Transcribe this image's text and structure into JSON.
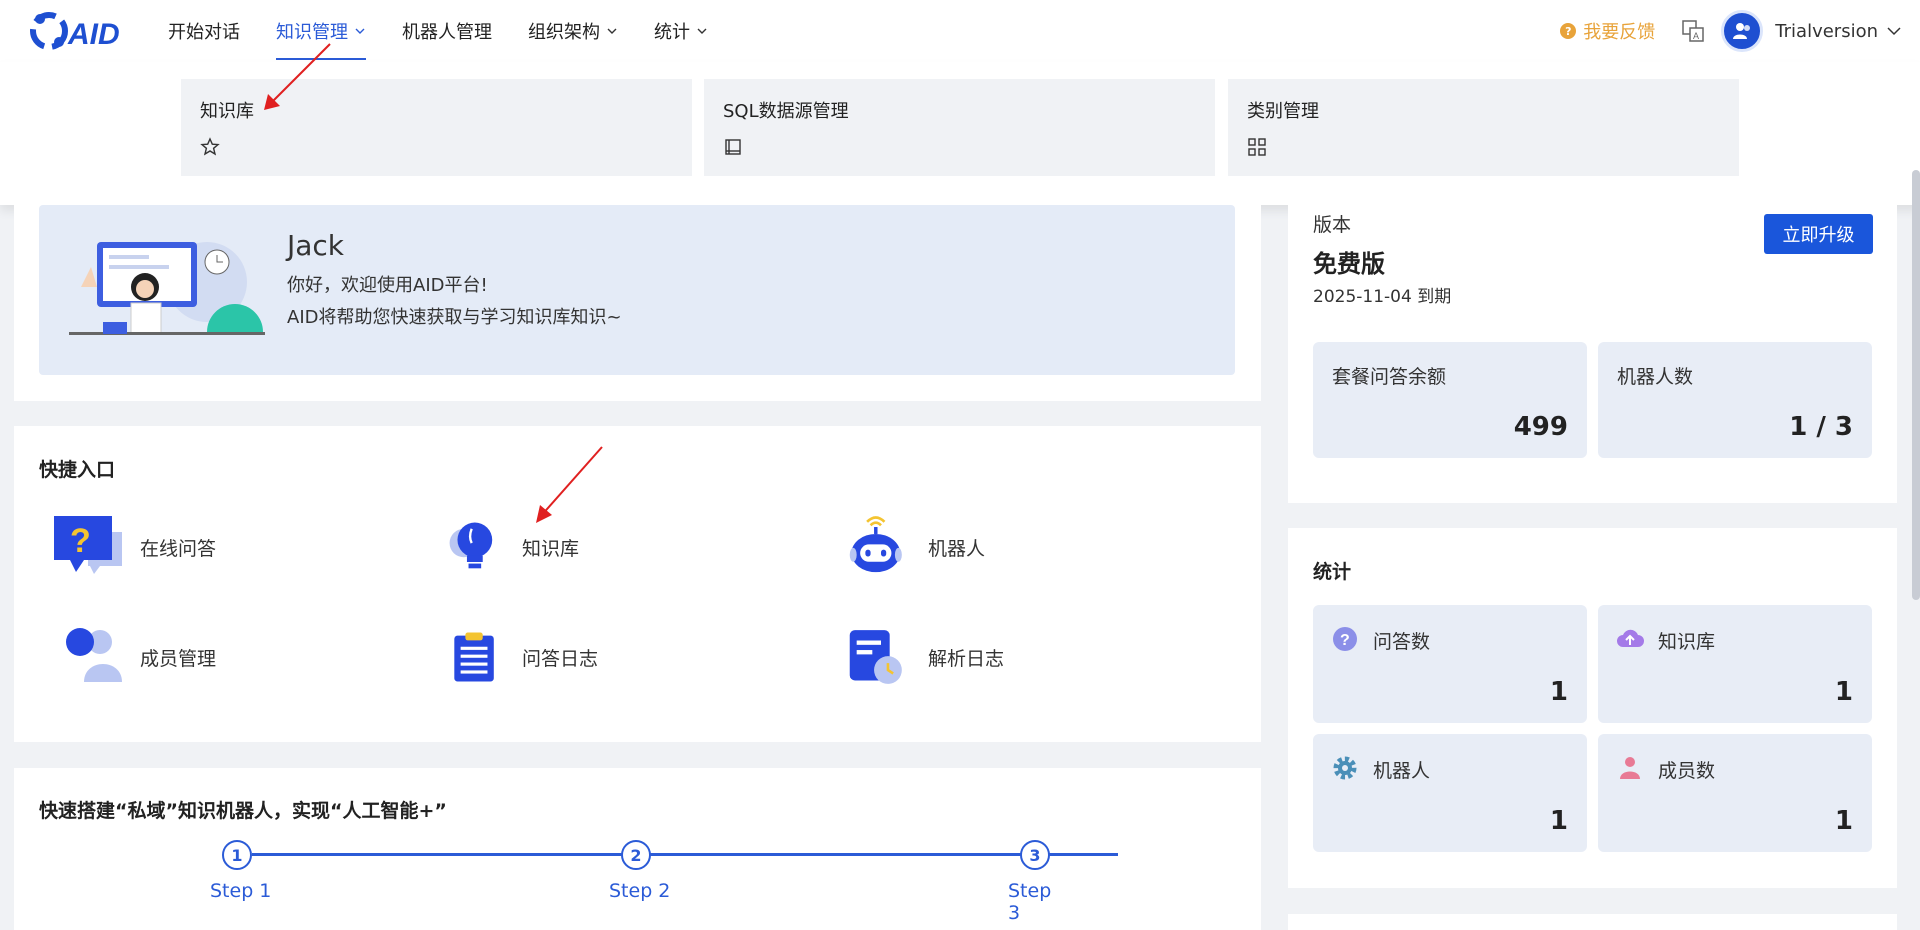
{
  "nav": {
    "items": [
      {
        "label": "开始对话",
        "has_chevron": false
      },
      {
        "label": "知识管理",
        "has_chevron": true,
        "active": true
      },
      {
        "label": "机器人管理",
        "has_chevron": false
      },
      {
        "label": "组织架构",
        "has_chevron": true
      },
      {
        "label": "统计",
        "has_chevron": true
      }
    ],
    "feedback": "我要反馈",
    "username": "Trialversion"
  },
  "dropdown": {
    "items": [
      {
        "label": "知识库",
        "icon": "star-icon"
      },
      {
        "label": "SQL数据源管理",
        "icon": "book-icon"
      },
      {
        "label": "类别管理",
        "icon": "grid-icon"
      }
    ]
  },
  "banner": {
    "name": "Jack",
    "line1": "你好，欢迎使用AID平台!",
    "line2": "AID将帮助您快速获取与学习知识库知识~"
  },
  "quick": {
    "title": "快捷入口",
    "items": [
      {
        "label": "在线问答",
        "icon": "question-bubble-icon"
      },
      {
        "label": "知识库",
        "icon": "lightbulb-icon"
      },
      {
        "label": "机器人",
        "icon": "robot-icon"
      },
      {
        "label": "成员管理",
        "icon": "users-icon"
      },
      {
        "label": "问答日志",
        "icon": "clipboard-icon"
      },
      {
        "label": "解析日志",
        "icon": "document-clock-icon"
      }
    ]
  },
  "build": {
    "title": "快速搭建“私域”知识机器人，实现“人工智能+”",
    "steps": [
      {
        "num": "1",
        "label": "Step 1"
      },
      {
        "num": "2",
        "label": "Step 2"
      },
      {
        "num": "3",
        "label": "Step 3"
      }
    ]
  },
  "version": {
    "label": "版本",
    "name": "免费版",
    "expiry": "2025-11-04 到期",
    "upgrade": "立即升级",
    "quota_label": "套餐问答余额",
    "quota_value": "499",
    "robots_label": "机器人数",
    "robots_value": "1 / 3"
  },
  "stats": {
    "title": "统计",
    "items": [
      {
        "label": "问答数",
        "value": "1",
        "icon": "question-circle-icon",
        "color": "#8b8fe8"
      },
      {
        "label": "知识库",
        "value": "1",
        "icon": "cloud-upload-icon",
        "color": "#a47ae8"
      },
      {
        "label": "机器人",
        "value": "1",
        "icon": "gear-icon",
        "color": "#4a8fb8"
      },
      {
        "label": "成员数",
        "value": "1",
        "icon": "person-icon",
        "color": "#e87a95"
      }
    ]
  }
}
